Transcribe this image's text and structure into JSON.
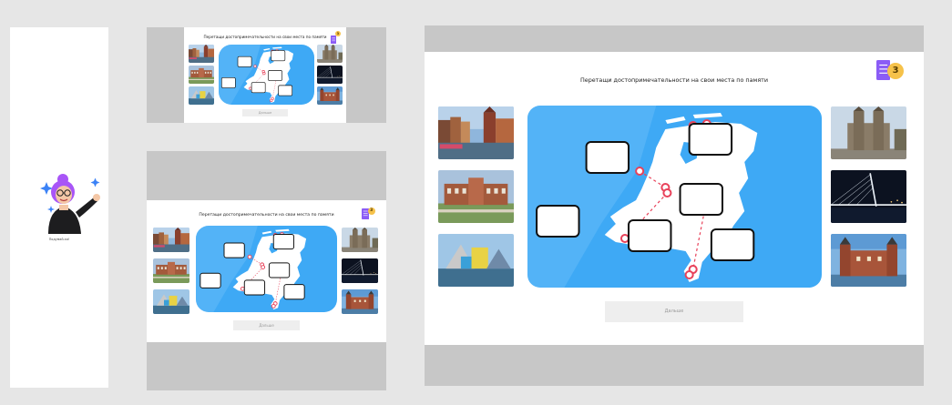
{
  "task": {
    "title": "Перетащи достопримечательности на свои места по памяти",
    "check_button_label": "Дальше",
    "score": "3"
  },
  "mascot": {
    "caption": "Подумай-ка!"
  },
  "colors": {
    "map_water": "#3ea9f5",
    "map_sea": "#7cc7fb",
    "land": "#ffffff",
    "marker": "#e8425a",
    "badge": "#f6c24a",
    "ticket": "#8b5cf6",
    "frame_gray": "#c7c7c7"
  },
  "photos_left": [
    "amsterdam-canal-photo",
    "het-loo-palace-photo",
    "groninger-museum-photo"
  ],
  "photos_right": [
    "maastricht-basilica-photo",
    "erasmus-bridge-photo",
    "muiderslot-castle-photo"
  ]
}
